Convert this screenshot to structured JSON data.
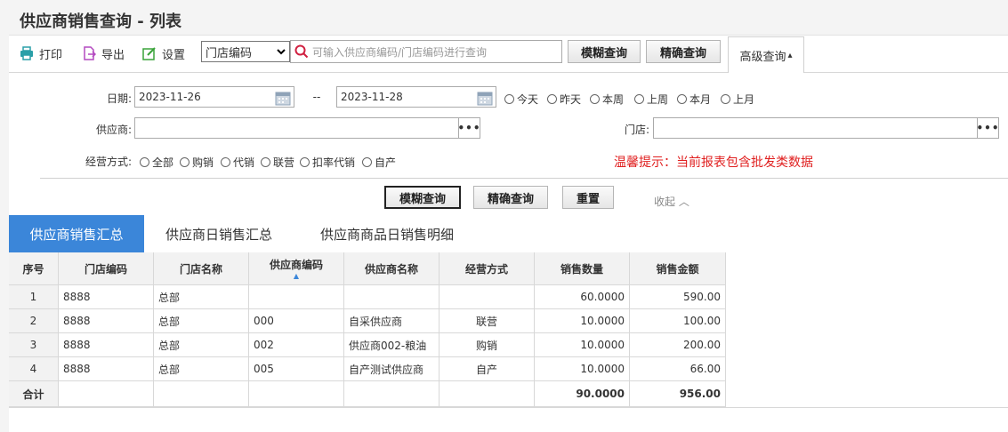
{
  "page": {
    "title": "供应商销售查询 - 列表"
  },
  "toolbar": {
    "print_label": "打印",
    "export_label": "导出",
    "settings_label": "设置",
    "field_select": "门店编码",
    "search_placeholder": "可输入供应商编码/门店编码进行查询",
    "fuzzy_label": "模糊查询",
    "exact_label": "精确查询",
    "advanced_label": "高级查询",
    "advanced_arrow": "▴"
  },
  "filter": {
    "date_label": "日期:",
    "date_from": "2023-11-26",
    "date_sep": "--",
    "date_to": "2023-11-28",
    "quick_dates": [
      "今天",
      "昨天",
      "本周",
      "上周",
      "本月",
      "上月"
    ],
    "supplier_label": "供应商:",
    "store_label": "门店:",
    "dots": "•••",
    "mode_label": "经营方式:",
    "modes": [
      "全部",
      "购销",
      "代销",
      "联营",
      "扣率代销",
      "自产"
    ],
    "hint": "温馨提示：当前报表包含批发类数据",
    "fuzzy_label": "模糊查询",
    "exact_label": "精确查询",
    "reset_label": "重置",
    "collapse_label": "收起 ︿"
  },
  "tabs": [
    "供应商销售汇总",
    "供应商日销售汇总",
    "供应商商品日销售明细"
  ],
  "table": {
    "headers": [
      "序号",
      "门店编码",
      "门店名称",
      "供应商编码",
      "供应商名称",
      "经营方式",
      "销售数量",
      "销售金额"
    ],
    "sort_arrow": "▲",
    "rows": [
      [
        "1",
        "8888",
        "总部",
        "",
        "",
        "",
        "60.0000",
        "590.00"
      ],
      [
        "2",
        "8888",
        "总部",
        "000",
        "自采供应商",
        "联营",
        "10.0000",
        "100.00"
      ],
      [
        "3",
        "8888",
        "总部",
        "002",
        "供应商002-粮油",
        "购销",
        "10.0000",
        "200.00"
      ],
      [
        "4",
        "8888",
        "总部",
        "005",
        "自产测试供应商",
        "自产",
        "10.0000",
        "66.00"
      ]
    ],
    "total": [
      "合计",
      "",
      "",
      "",
      "",
      "",
      "90.0000",
      "956.00"
    ]
  },
  "colors": {
    "accent": "#3b86d9",
    "hint": "#e02020"
  }
}
